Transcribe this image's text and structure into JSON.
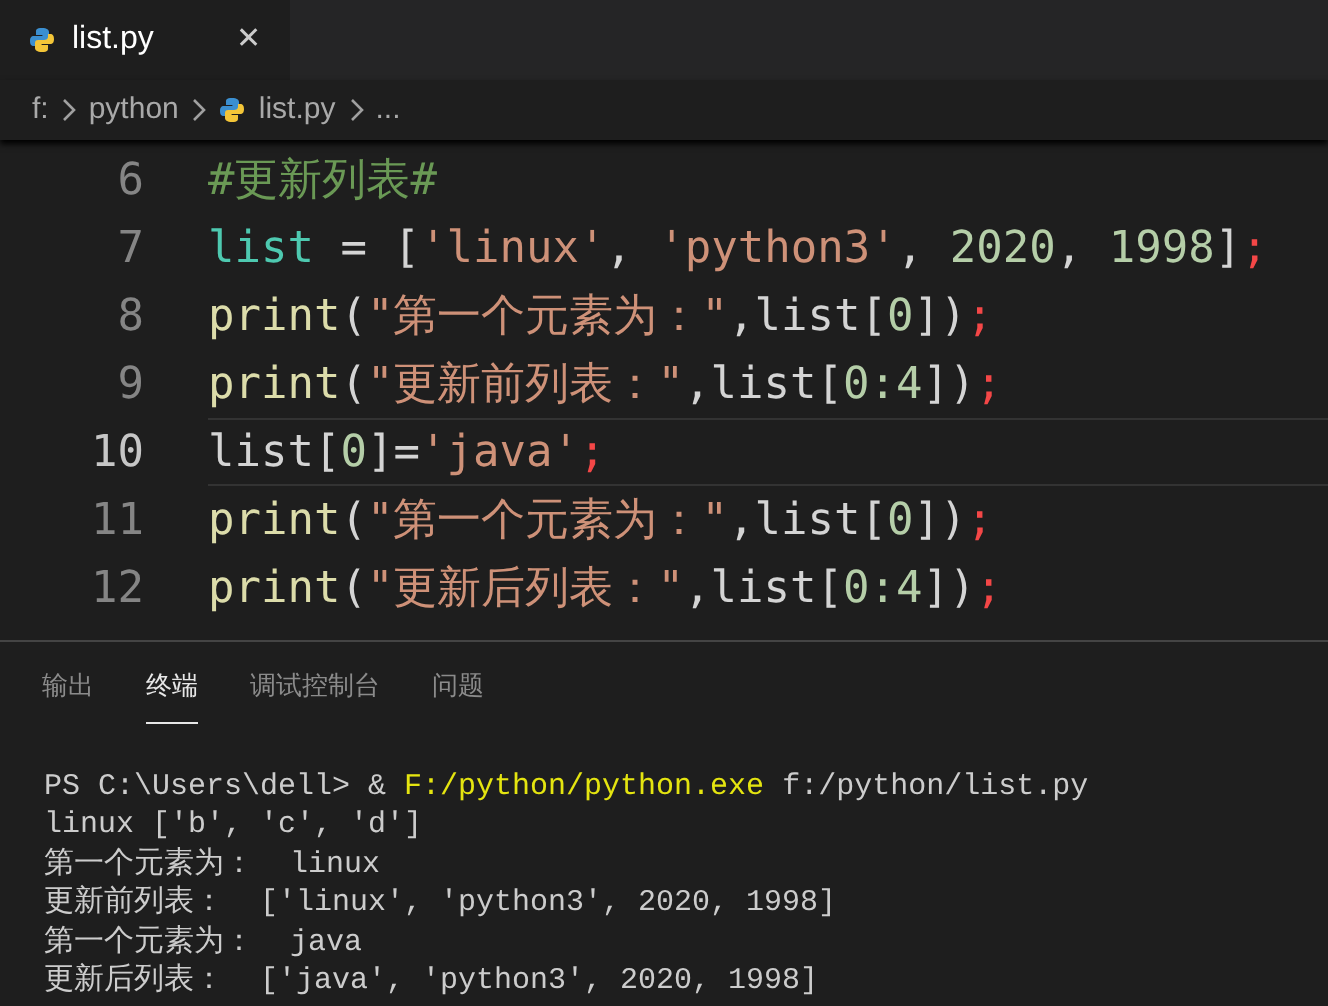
{
  "tabs": [
    {
      "label": "list.py",
      "selected": true,
      "close": "✕"
    }
  ],
  "breadcrumb": [
    "f:",
    "python",
    "list.py",
    "..."
  ],
  "editor": {
    "lines": [
      {
        "number": "6",
        "current": false,
        "tokens": [
          {
            "kind": "comment",
            "text": "#更新列表#"
          }
        ]
      },
      {
        "number": "7",
        "current": false,
        "tokens": [
          {
            "kind": "variable",
            "text": "list"
          },
          {
            "kind": "plain",
            "text": " = ["
          },
          {
            "kind": "string",
            "text": "'linux'"
          },
          {
            "kind": "plain",
            "text": ", "
          },
          {
            "kind": "string",
            "text": "'python3'"
          },
          {
            "kind": "plain",
            "text": ", "
          },
          {
            "kind": "number",
            "text": "2020"
          },
          {
            "kind": "plain",
            "text": ", "
          },
          {
            "kind": "number",
            "text": "1998"
          },
          {
            "kind": "plain",
            "text": "]"
          },
          {
            "kind": "error",
            "text": ";"
          }
        ]
      },
      {
        "number": "8",
        "current": false,
        "tokens": [
          {
            "kind": "function",
            "text": "print"
          },
          {
            "kind": "plain",
            "text": "("
          },
          {
            "kind": "string",
            "text": "\"第一个元素为：\""
          },
          {
            "kind": "plain",
            "text": ",list["
          },
          {
            "kind": "number",
            "text": "0"
          },
          {
            "kind": "plain",
            "text": "])"
          },
          {
            "kind": "error",
            "text": ";"
          }
        ]
      },
      {
        "number": "9",
        "current": false,
        "tokens": [
          {
            "kind": "function",
            "text": "print"
          },
          {
            "kind": "plain",
            "text": "("
          },
          {
            "kind": "string",
            "text": "\"更新前列表：\""
          },
          {
            "kind": "plain",
            "text": ",list["
          },
          {
            "kind": "number",
            "text": "0:4"
          },
          {
            "kind": "plain",
            "text": "])"
          },
          {
            "kind": "error",
            "text": ";"
          }
        ]
      },
      {
        "number": "10",
        "current": true,
        "tokens": [
          {
            "kind": "plain",
            "text": "list["
          },
          {
            "kind": "number",
            "text": "0"
          },
          {
            "kind": "plain",
            "text": "]="
          },
          {
            "kind": "string",
            "text": "'java'"
          },
          {
            "kind": "error",
            "text": ";"
          }
        ]
      },
      {
        "number": "11",
        "current": false,
        "tokens": [
          {
            "kind": "function",
            "text": "print"
          },
          {
            "kind": "plain",
            "text": "("
          },
          {
            "kind": "string",
            "text": "\"第一个元素为：\""
          },
          {
            "kind": "plain",
            "text": ",list["
          },
          {
            "kind": "number",
            "text": "0"
          },
          {
            "kind": "plain",
            "text": "])"
          },
          {
            "kind": "error",
            "text": ";"
          }
        ]
      },
      {
        "number": "12",
        "current": false,
        "tokens": [
          {
            "kind": "function",
            "text": "print"
          },
          {
            "kind": "plain",
            "text": "("
          },
          {
            "kind": "string",
            "text": "\"更新后列表：\""
          },
          {
            "kind": "plain",
            "text": ",list["
          },
          {
            "kind": "number",
            "text": "0:4"
          },
          {
            "kind": "plain",
            "text": "])"
          },
          {
            "kind": "error",
            "text": ";"
          }
        ]
      }
    ]
  },
  "panel": {
    "tabs": [
      {
        "label": "输出",
        "selected": false
      },
      {
        "label": "终端",
        "selected": true
      },
      {
        "label": "调试控制台",
        "selected": false
      },
      {
        "label": "问题",
        "selected": false
      }
    ],
    "terminal": [
      {
        "tokens": [
          {
            "kind": "plain",
            "text": "PS C:\\Users\\dell> & "
          },
          {
            "kind": "command",
            "text": "F:/python/python.exe"
          },
          {
            "kind": "plain",
            "text": " f:/python/list.py"
          }
        ]
      },
      {
        "tokens": [
          {
            "kind": "plain",
            "text": "linux ['b', 'c', 'd']"
          }
        ]
      },
      {
        "tokens": [
          {
            "kind": "plain",
            "text": "第一个元素为：  linux"
          }
        ]
      },
      {
        "tokens": [
          {
            "kind": "plain",
            "text": "更新前列表：  ['linux', 'python3', 2020, 1998]"
          }
        ]
      },
      {
        "tokens": [
          {
            "kind": "plain",
            "text": "第一个元素为：  java"
          }
        ]
      },
      {
        "tokens": [
          {
            "kind": "plain",
            "text": "更新后列表：  ['java', 'python3', 2020, 1998]"
          }
        ]
      }
    ]
  }
}
